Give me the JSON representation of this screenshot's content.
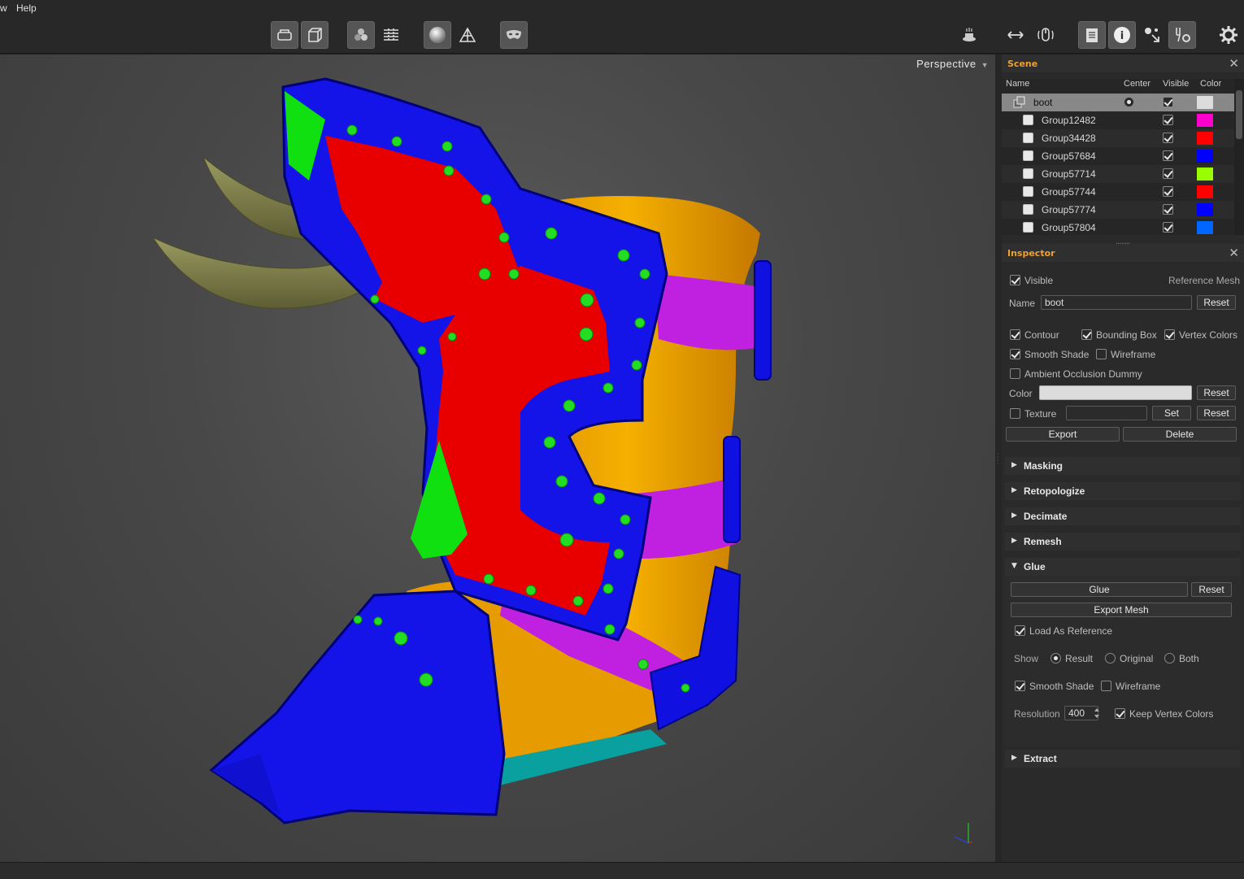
{
  "menu": {
    "left_fragment": "w",
    "help": "Help"
  },
  "toolbar": {
    "buttons": [
      "layers-icon",
      "cube-icon",
      "material-icon",
      "grid-icon",
      "sphere-icon",
      "wireframe-icon",
      "mask-icon"
    ],
    "right_buttons": [
      "turntable-icon",
      "arrows-icon",
      "mouse-icon",
      "clipboard-icon",
      "info-icon",
      "pose-icon",
      "tools-icon",
      "gear-icon"
    ]
  },
  "viewport": {
    "projection": "Perspective"
  },
  "scene": {
    "title": "Scene",
    "columns": {
      "name": "Name",
      "center": "Center",
      "visible": "Visible",
      "color": "Color"
    },
    "items": [
      {
        "name": "boot",
        "color": "#dcdcdc",
        "visible": true,
        "selected": true,
        "root": true
      },
      {
        "name": "Group12482",
        "color": "#ff00cc",
        "visible": true
      },
      {
        "name": "Group34428",
        "color": "#ff0000",
        "visible": true
      },
      {
        "name": "Group57684",
        "color": "#0000ff",
        "visible": true
      },
      {
        "name": "Group57714",
        "color": "#99ff00",
        "visible": true
      },
      {
        "name": "Group57744",
        "color": "#ff0000",
        "visible": true
      },
      {
        "name": "Group57774",
        "color": "#0000ff",
        "visible": true
      },
      {
        "name": "Group57804",
        "color": "#0066ff",
        "visible": true
      }
    ]
  },
  "inspector": {
    "title": "Inspector",
    "visible_label": "Visible",
    "reference_mesh": "Reference Mesh",
    "name_label": "Name",
    "name_value": "boot",
    "reset": "Reset",
    "contour": "Contour",
    "bounding_box": "Bounding Box",
    "vertex_colors": "Vertex Colors",
    "smooth_shade": "Smooth Shade",
    "wireframe": "Wireframe",
    "ambient_occlusion": "Ambient Occlusion Dummy",
    "color_label": "Color",
    "texture_label": "Texture",
    "set": "Set",
    "export": "Export",
    "delete": "Delete"
  },
  "sections": {
    "masking": "Masking",
    "retopologize": "Retopologize",
    "decimate": "Decimate",
    "remesh": "Remesh",
    "glue": "Glue",
    "extract": "Extract"
  },
  "glue": {
    "glue_button": "Glue",
    "reset": "Reset",
    "export_mesh": "Export Mesh",
    "load_as_reference": "Load As Reference",
    "show_label": "Show",
    "result": "Result",
    "original": "Original",
    "both": "Both",
    "smooth_shade": "Smooth Shade",
    "wireframe": "Wireframe",
    "resolution_label": "Resolution",
    "resolution_value": "400",
    "keep_vertex_colors": "Keep Vertex Colors"
  },
  "colors": {
    "accent": "#f0a030",
    "panel": "#2a2a2a",
    "viewport": "#4a4a4a"
  }
}
